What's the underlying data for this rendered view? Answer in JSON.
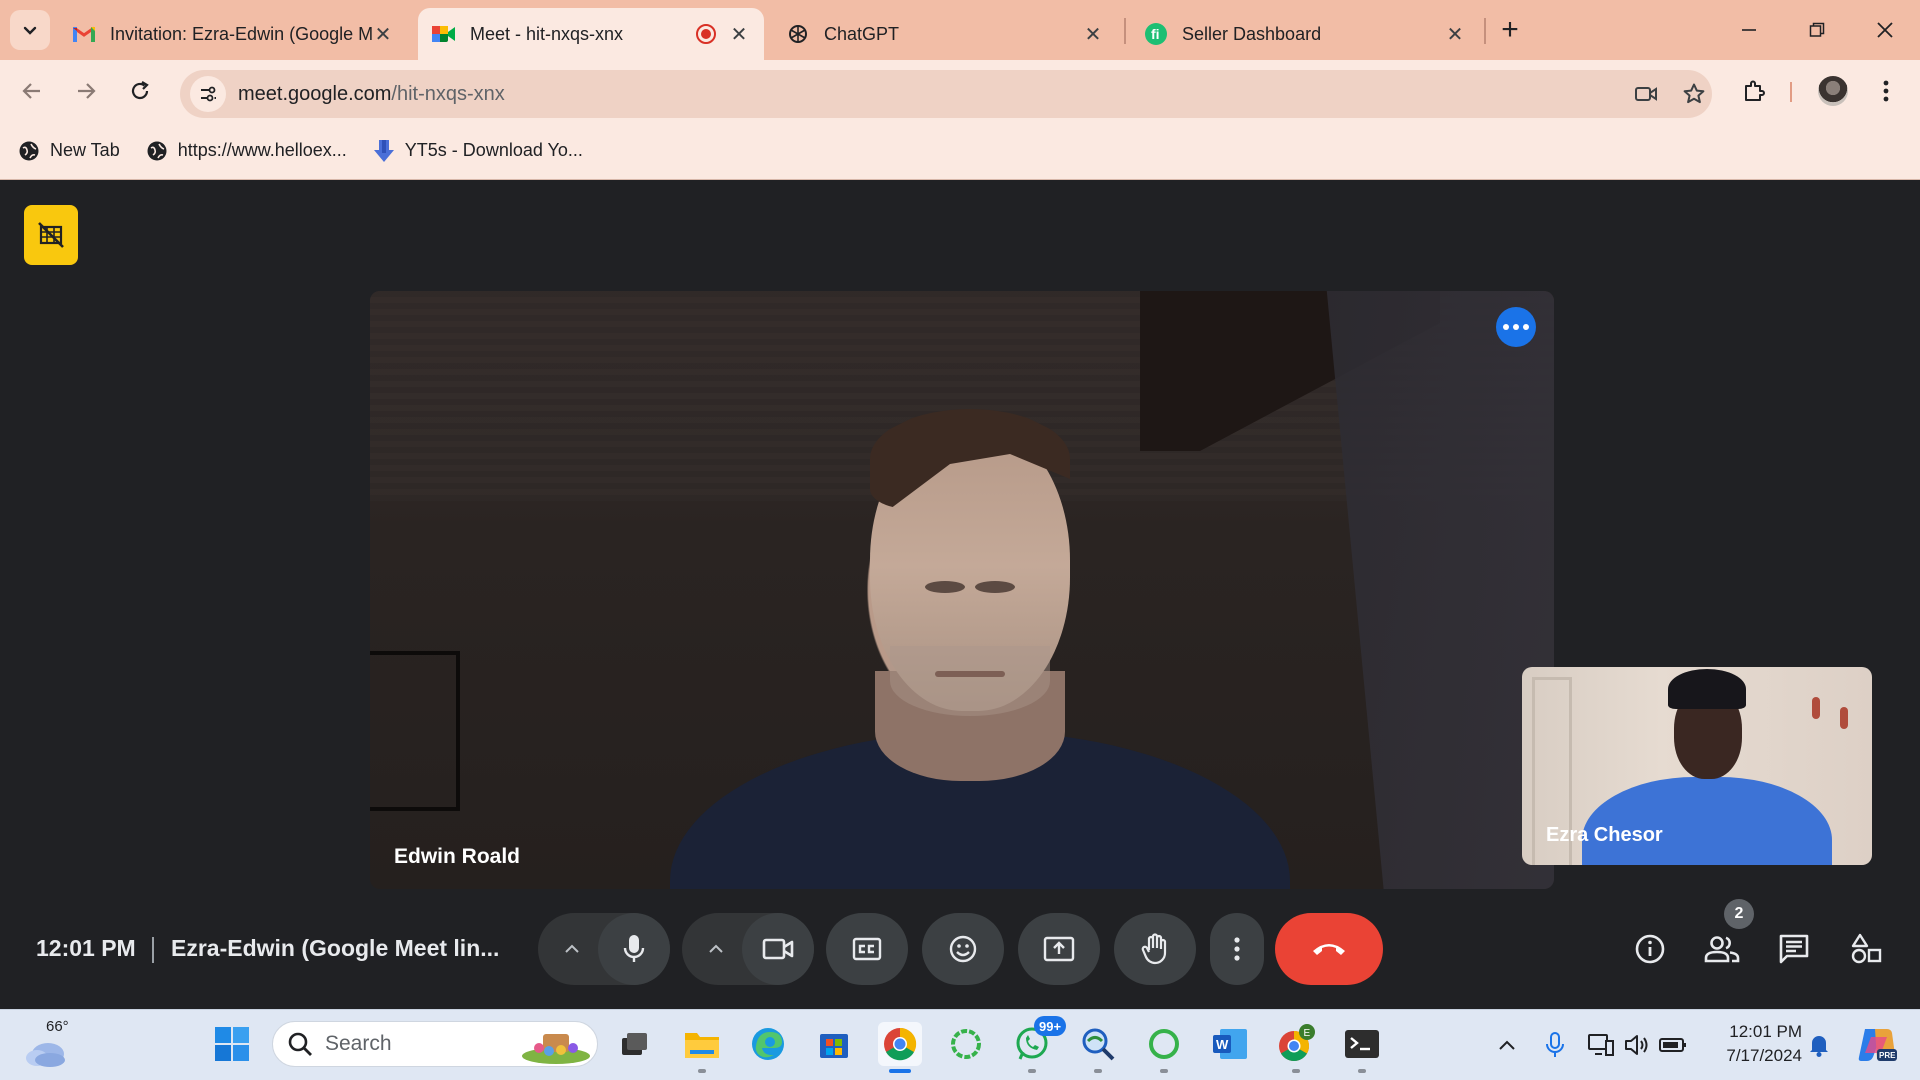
{
  "browser": {
    "tabs": [
      {
        "title": "Invitation: Ezra-Edwin (Google M",
        "favicon": "gmail-icon"
      },
      {
        "title": "Meet - hit-nxqs-xnx",
        "favicon": "google-meet-icon",
        "active": true,
        "recording": true
      },
      {
        "title": "ChatGPT",
        "favicon": "chatgpt-icon"
      },
      {
        "title": "Seller Dashboard",
        "favicon": "fiverr-icon"
      }
    ],
    "url_host": "meet.google.com",
    "url_path": "/hit-nxqs-xnx",
    "bookmarks": [
      {
        "label": "New Tab",
        "icon": "globe-icon"
      },
      {
        "label": "https://www.helloex...",
        "icon": "globe-icon"
      },
      {
        "label": "YT5s - Download Yo...",
        "icon": "download-arrow-icon"
      }
    ]
  },
  "meet": {
    "main_participant": "Edwin Roald",
    "self_participant": "Ezra Chesor",
    "time": "12:01 PM",
    "meeting_title": "Ezra-Edwin (Google Meet lin...",
    "people_count": "2",
    "colors": {
      "end_call": "#ea4335",
      "host_badge": "#f9c80e",
      "more_button": "#1a73e8"
    }
  },
  "taskbar": {
    "weather_temp": "66°",
    "search_placeholder": "Search",
    "whatsapp_badge": "99+",
    "clock_time": "12:01 PM",
    "clock_date": "7/17/2024"
  }
}
